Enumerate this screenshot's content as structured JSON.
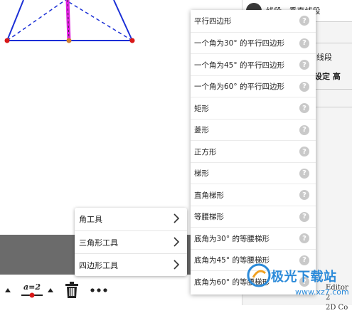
{
  "right_panel": {
    "top_text": "线段 · 垂直线段",
    "line1": "线段",
    "line2": "设定 高",
    "editor_line1": "Editor 2",
    "editor_line2": "2D Co"
  },
  "toolbar": {
    "slider_label": "a=2"
  },
  "main_menu": [
    {
      "label": "角工具"
    },
    {
      "label": "三角形工具"
    },
    {
      "label": "四边形工具"
    }
  ],
  "submenu": [
    {
      "label": "平行四边形"
    },
    {
      "label": "一个角为30° 的平行四边形"
    },
    {
      "label": "一个角为45° 的平行四边形"
    },
    {
      "label": "一个角为60° 的平行四边形"
    },
    {
      "label": "矩形"
    },
    {
      "label": "菱形"
    },
    {
      "label": "正方形"
    },
    {
      "label": "梯形"
    },
    {
      "label": "直角梯形"
    },
    {
      "label": "等腰梯形"
    },
    {
      "label": "底角为30° 的等腰梯形"
    },
    {
      "label": "底角为45° 的等腰梯形"
    },
    {
      "label": "底角为60° 的等腰梯形"
    }
  ],
  "watermark": {
    "title": "极光下载站",
    "url": "www.xz7.com"
  },
  "colors": {
    "triangle_blue": "#1b2fd6",
    "segment_magenta": "#e020e0",
    "point_red": "#d81818",
    "help_gray": "#c9c9c9",
    "brand_blue": "#2b8ad9"
  },
  "icons": {
    "delete": "trash-icon",
    "more": "more-dots-icon",
    "submenu_arrow": "chevron-right-icon",
    "help": "help-circle-icon"
  }
}
